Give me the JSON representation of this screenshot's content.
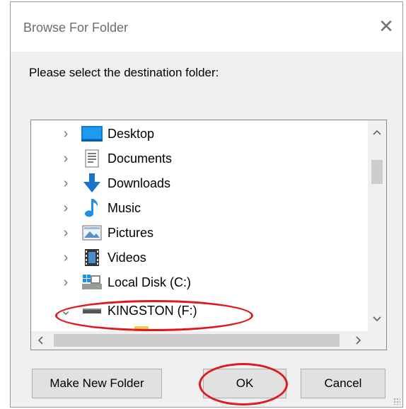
{
  "window": {
    "title": "Browse For Folder",
    "close_symbol": "✕"
  },
  "prompt": "Please select the destination folder:",
  "tree": {
    "items": [
      {
        "label": "Desktop",
        "icon": "desktop-icon",
        "expander": "›"
      },
      {
        "label": "Documents",
        "icon": "documents-icon",
        "expander": "›"
      },
      {
        "label": "Downloads",
        "icon": "downloads-icon",
        "expander": "›"
      },
      {
        "label": "Music",
        "icon": "music-icon",
        "expander": "›"
      },
      {
        "label": "Pictures",
        "icon": "pictures-icon",
        "expander": "›"
      },
      {
        "label": "Videos",
        "icon": "videos-icon",
        "expander": "›"
      },
      {
        "label": "Local Disk (C:)",
        "icon": "local-disk-icon",
        "expander": "›"
      },
      {
        "label": "KINGSTON (F:)",
        "icon": "usb-drive-icon",
        "expander": "⌄"
      }
    ]
  },
  "buttons": {
    "make_new_folder": "Make New Folder",
    "ok": "OK",
    "cancel": "Cancel"
  },
  "colors": {
    "annotation": "#e0191e",
    "accent_blue": "#0078d7"
  }
}
